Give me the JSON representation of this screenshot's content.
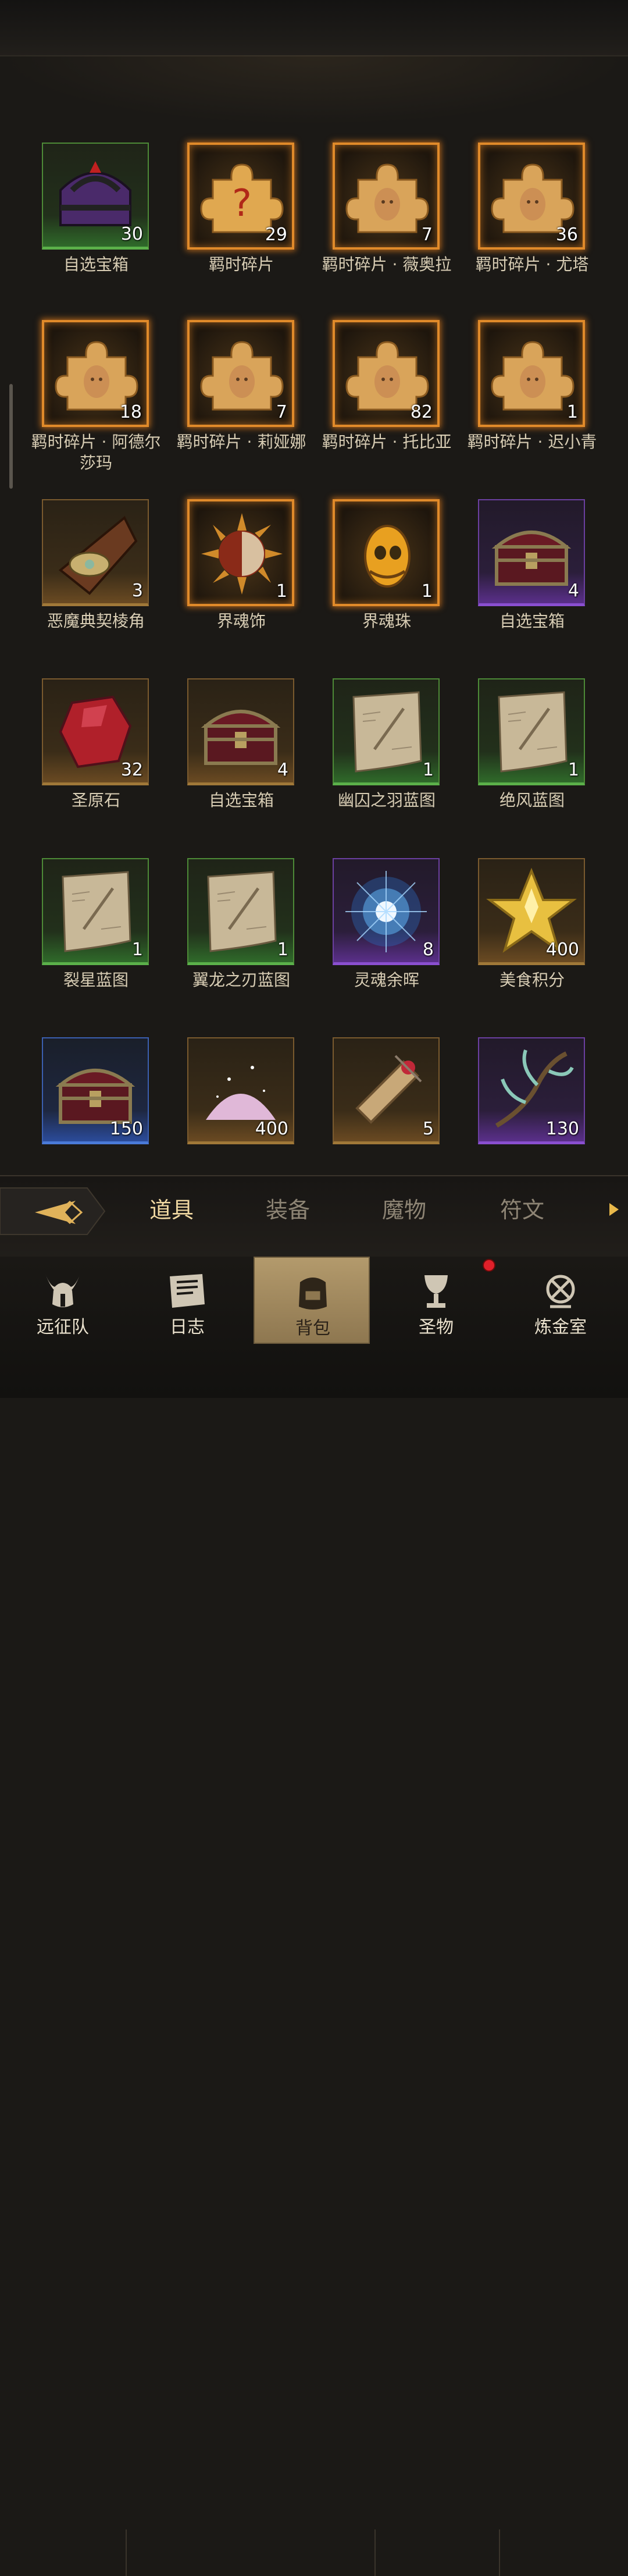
{
  "items": [
    {
      "name": "自选宝箱",
      "count": "30",
      "frame": "green",
      "icon": "purple-chest-icon"
    },
    {
      "name": "羁时碎片",
      "count": "29",
      "frame": "fire",
      "icon": "puzzle-question-icon"
    },
    {
      "name": "羁时碎片 · 薇奥拉",
      "count": "7",
      "frame": "fire",
      "icon": "puzzle-portrait-icon"
    },
    {
      "name": "羁时碎片 · 尤塔",
      "count": "36",
      "frame": "fire",
      "icon": "puzzle-portrait-icon"
    },
    {
      "name": "羁时碎片 · 阿德尔莎玛",
      "count": "18",
      "frame": "fire",
      "icon": "puzzle-portrait-icon"
    },
    {
      "name": "羁时碎片 · 莉娅娜",
      "count": "7",
      "frame": "fire",
      "icon": "puzzle-portrait-icon"
    },
    {
      "name": "羁时碎片 · 托比亚",
      "count": "82",
      "frame": "fire",
      "icon": "puzzle-portrait-icon"
    },
    {
      "name": "羁时碎片 · 迟小青",
      "count": "1",
      "frame": "fire",
      "icon": "puzzle-portrait-icon"
    },
    {
      "name": "恶魔典契棱角",
      "count": "3",
      "frame": "gold",
      "icon": "demon-corner-icon"
    },
    {
      "name": "界魂饰",
      "count": "1",
      "frame": "fire",
      "icon": "sun-mask-icon"
    },
    {
      "name": "界魂珠",
      "count": "1",
      "frame": "fire",
      "icon": "soul-bead-icon"
    },
    {
      "name": "自选宝箱",
      "count": "4",
      "frame": "purple",
      "icon": "treasure-chest-icon"
    },
    {
      "name": "圣原石",
      "count": "32",
      "frame": "gold",
      "icon": "red-crystal-icon"
    },
    {
      "name": "自选宝箱",
      "count": "4",
      "frame": "gold",
      "icon": "treasure-chest-icon"
    },
    {
      "name": "幽囚之羽蓝图",
      "count": "1",
      "frame": "green",
      "icon": "blueprint-scroll-icon"
    },
    {
      "name": "绝风蓝图",
      "count": "1",
      "frame": "green",
      "icon": "blueprint-scroll-icon"
    },
    {
      "name": "裂星蓝图",
      "count": "1",
      "frame": "green",
      "icon": "blueprint-scroll-icon"
    },
    {
      "name": "翼龙之刃蓝图",
      "count": "1",
      "frame": "green",
      "icon": "blueprint-scroll-icon"
    },
    {
      "name": "灵魂余晖",
      "count": "8",
      "frame": "purple",
      "icon": "blue-spark-icon"
    },
    {
      "name": "美食积分",
      "count": "400",
      "frame": "gold",
      "icon": "gold-star-icon"
    },
    {
      "name": "",
      "count": "150",
      "frame": "blue",
      "icon": "treasure-chest-icon"
    },
    {
      "name": "",
      "count": "400",
      "frame": "gold",
      "icon": "pink-dust-icon"
    },
    {
      "name": "",
      "count": "5",
      "frame": "gold",
      "icon": "rolled-scroll-icon"
    },
    {
      "name": "",
      "count": "130",
      "frame": "purple",
      "icon": "vine-branch-icon"
    }
  ],
  "tabs": {
    "active_index": 0,
    "labels": [
      "道具",
      "装备",
      "魔物",
      "符文"
    ]
  },
  "nav": {
    "active_index": 2,
    "labels": [
      "远征队",
      "日志",
      "背包",
      "圣物",
      "炼金室"
    ],
    "icons": [
      "viking-helmet-icon",
      "journal-icon",
      "backpack-icon",
      "chalice-icon",
      "alchemy-icon"
    ],
    "badge_on": "圣物"
  },
  "colors": {
    "fire_border": "#e08a2a",
    "green_frame": "#5bb04a",
    "purple_frame": "#8a4fd0",
    "blue_frame": "#4a7ad8",
    "gold_frame": "#a07838",
    "active_tab_text": "#f1d9a2",
    "badge": "#e0202a"
  }
}
